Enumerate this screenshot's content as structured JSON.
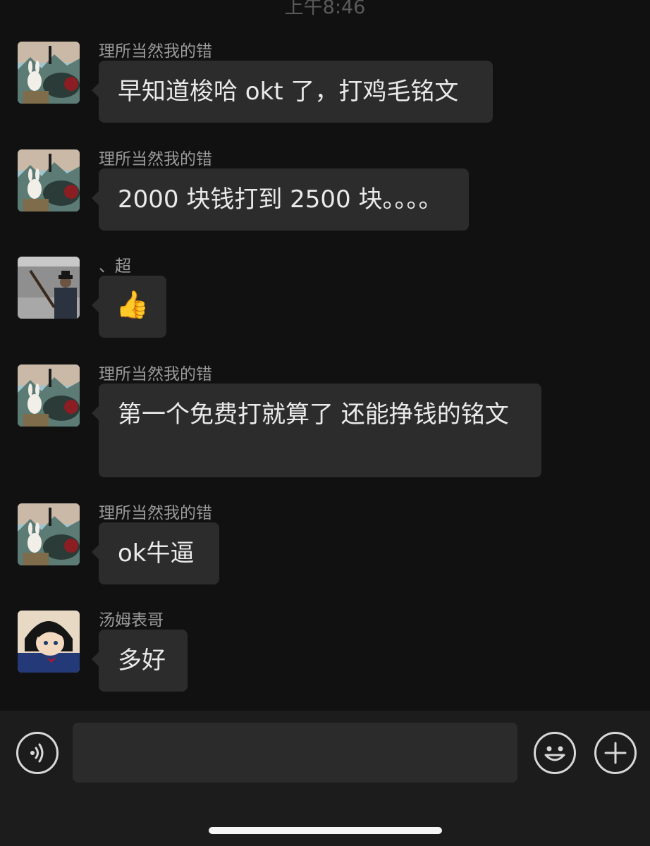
{
  "status": {
    "time": "上午8:46"
  },
  "messages": [
    {
      "sender": "理所当然我的错",
      "text": "早知道梭哈 okt 了，打鸡毛铭文",
      "avatar": "rabbit-landscape-avatar"
    },
    {
      "sender": "理所当然我的错",
      "text": "2000 块钱打到 2500 块。。。。",
      "avatar": "rabbit-landscape-avatar"
    },
    {
      "sender": "、超",
      "text": "👍",
      "avatar": "man-with-rifle-avatar"
    },
    {
      "sender": "理所当然我的错",
      "text": "第一个免费打就算了  还能挣钱的铭文",
      "avatar": "rabbit-landscape-avatar"
    },
    {
      "sender": "理所当然我的错",
      "text": "ok牛逼",
      "avatar": "rabbit-landscape-avatar"
    },
    {
      "sender": "汤姆表哥",
      "text": "多好",
      "avatar": "anime-detective-avatar"
    }
  ],
  "input_bar": {
    "placeholder": "",
    "voice_icon": "voice-icon",
    "emoji_icon": "emoji-icon",
    "plus_icon": "plus-icon"
  },
  "colors": {
    "background": "#111111",
    "bubble": "#2c2c2c",
    "sender_text": "#9a9a9a",
    "input_bar": "#1c1c1c"
  }
}
